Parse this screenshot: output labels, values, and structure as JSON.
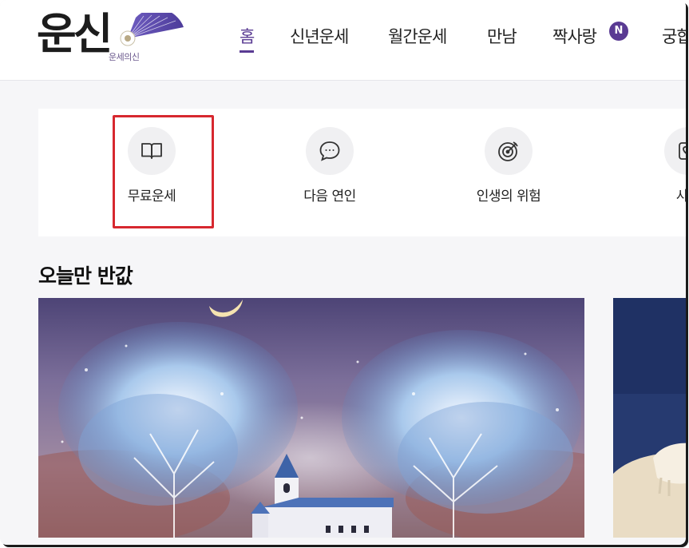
{
  "logo": {
    "main": "운신",
    "sub": "운세의신"
  },
  "nav": {
    "items": [
      {
        "label": "홈",
        "active": true
      },
      {
        "label": "신년운세"
      },
      {
        "label": "월간운세"
      },
      {
        "label": "만남"
      },
      {
        "label": "짝사랑"
      },
      {
        "label": "궁합"
      }
    ],
    "badge": "N"
  },
  "categories": [
    {
      "label": "무료운세",
      "icon": "book-icon"
    },
    {
      "label": "다음 연인",
      "icon": "chat-bubble-icon"
    },
    {
      "label": "인생의 위험",
      "icon": "target-icon"
    },
    {
      "label": "사귈",
      "icon": "heart-card-icon"
    }
  ],
  "section": {
    "title": "오늘만 반값"
  },
  "colors": {
    "accent": "#5a3b93",
    "highlight": "#d7282f"
  }
}
